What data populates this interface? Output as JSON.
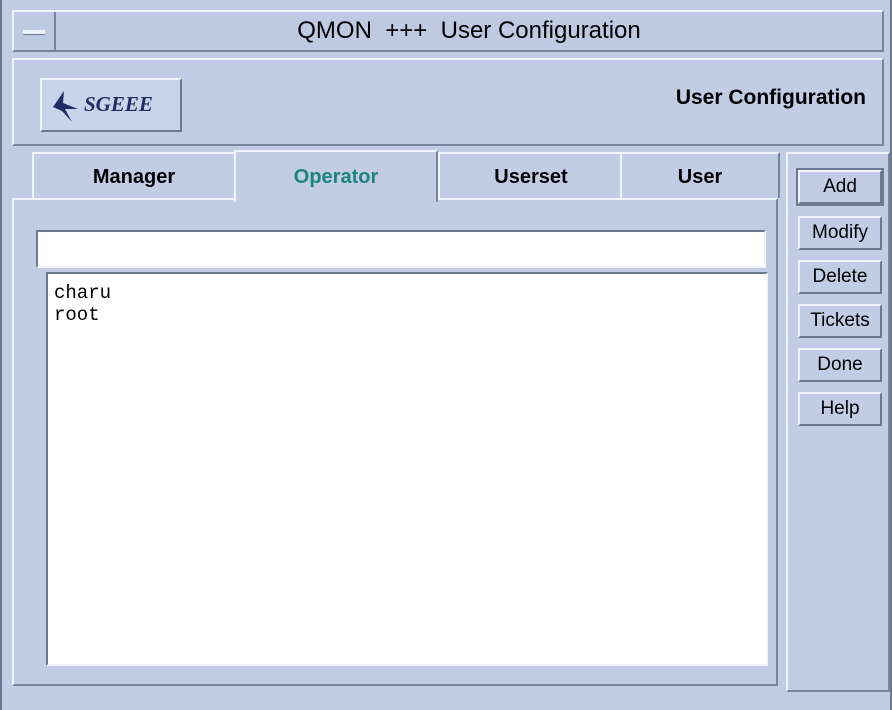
{
  "window": {
    "title": "QMON  +++  User Configuration"
  },
  "header": {
    "logo_text": "SGEEE",
    "title": "User Configuration"
  },
  "tabs": [
    {
      "label": "Manager",
      "active": false
    },
    {
      "label": "Operator",
      "active": true
    },
    {
      "label": "Userset",
      "active": false
    },
    {
      "label": "User",
      "active": false
    }
  ],
  "input": {
    "value": ""
  },
  "list": {
    "items": [
      "charu",
      "root"
    ]
  },
  "buttons": {
    "add": "Add",
    "modify": "Modify",
    "delete": "Delete",
    "tickets": "Tickets",
    "done": "Done",
    "help": "Help"
  },
  "colors": {
    "background": "#c2cde5",
    "active_tab_text": "#1b8480",
    "logo_text": "#1f2f66"
  }
}
